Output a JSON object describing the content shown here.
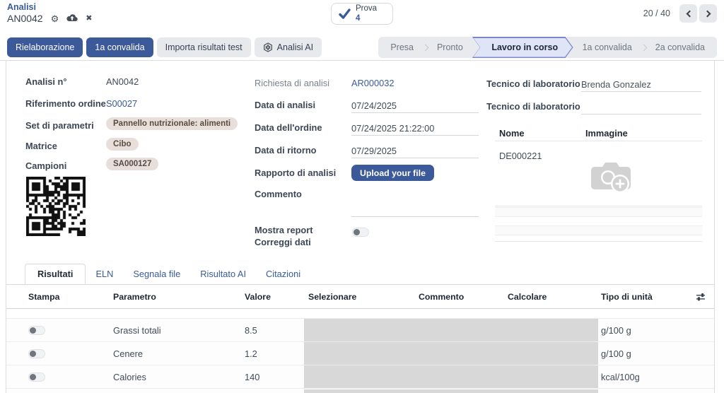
{
  "colors": {
    "primary": "#3c5a9a",
    "link": "#3a5a9a",
    "badge_bg": "#e8dfdb",
    "badge_text": "#594a44",
    "statusbar_bg": "#e9eaee",
    "active_step_bg": "#dfe4f6",
    "active_step_border": "#7a88c9",
    "muted_cell": "#d8d8d8"
  },
  "icons": {
    "gear_glyph": "⚙",
    "close_glyph": "✖",
    "cloud_upload": "cloud-upload",
    "check": "checkmark",
    "prev": "chevron-left",
    "next": "chevron-right",
    "ai_logo": "openai-hexagon",
    "camera_add": "camera-plus-placeholder",
    "adjust_columns": "sliders"
  },
  "breadcrumb": {
    "app": "Analisi",
    "record": "AN0042"
  },
  "stat_button": {
    "label": "Prova",
    "value": "4"
  },
  "pager": {
    "counter": "20 / 40"
  },
  "actions": {
    "reprocess": "Rielaborazione",
    "first_validation": "1a convalida",
    "import_results": "Importa risultati test",
    "ai_analysis": "Analisi AI"
  },
  "statusbar": {
    "steps": [
      "Presa",
      "Pronto",
      "Lavoro in corso",
      "1a convalida",
      "2a convalida"
    ],
    "active": "Lavoro in corso"
  },
  "form": {
    "left": {
      "analysis_no_label": "Analisi n°",
      "analysis_no_value": "AN0042",
      "order_ref_label": "Riferimento ordine",
      "order_ref_value": "S00027",
      "param_set_label": "Set di parametri",
      "param_set_value": "Pannello nutrizionale: alimenti",
      "matrix_label": "Matrice",
      "matrix_value": "Cibo",
      "samples_label": "Campioni",
      "samples_value": "SA000127"
    },
    "middle": {
      "request_label": "Richiesta di analisi",
      "request_value": "AR000032",
      "analysis_date_label": "Data di analisi",
      "analysis_date_value": "07/24/2025",
      "order_date_label": "Data dell'ordine",
      "order_date_value": "07/24/2025 21:22:00",
      "return_date_label": "Data di ritorno",
      "return_date_value": "07/29/2025",
      "report_label": "Rapporto di analisi",
      "upload_button": "Upload your file",
      "comment_label": "Commento",
      "comment_value": "",
      "show_report_label": "Mostra report",
      "fix_data_label": "Correggi dati"
    },
    "right": {
      "tech1_label": "Tecnico di laboratorio",
      "tech1_value": "Brenda Gonzalez",
      "tech2_label": "Tecnico di laboratorio",
      "tech2_value": "",
      "images_table": {
        "name_header": "Nome",
        "image_header": "Immagine",
        "row_name": "DE000221"
      }
    }
  },
  "tabs": {
    "items": [
      "Risultati",
      "ELN",
      "Segnala file",
      "Risultato AI",
      "Citazioni"
    ],
    "active": "Risultati"
  },
  "results": {
    "headers": {
      "print": "Stampa",
      "parameter": "Parametro",
      "value": "Valore",
      "select": "Selezionare",
      "comment": "Commento",
      "compute": "Calcolare",
      "unit": "Tipo di unità"
    },
    "rows": [
      {
        "parameter": "Grassi totali",
        "value": "8.5",
        "unit": "g/100 g"
      },
      {
        "parameter": "Cenere",
        "value": "1.2",
        "unit": "g/100 g"
      },
      {
        "parameter": "Calories",
        "value": "140",
        "unit": "kcal/100g"
      }
    ]
  }
}
